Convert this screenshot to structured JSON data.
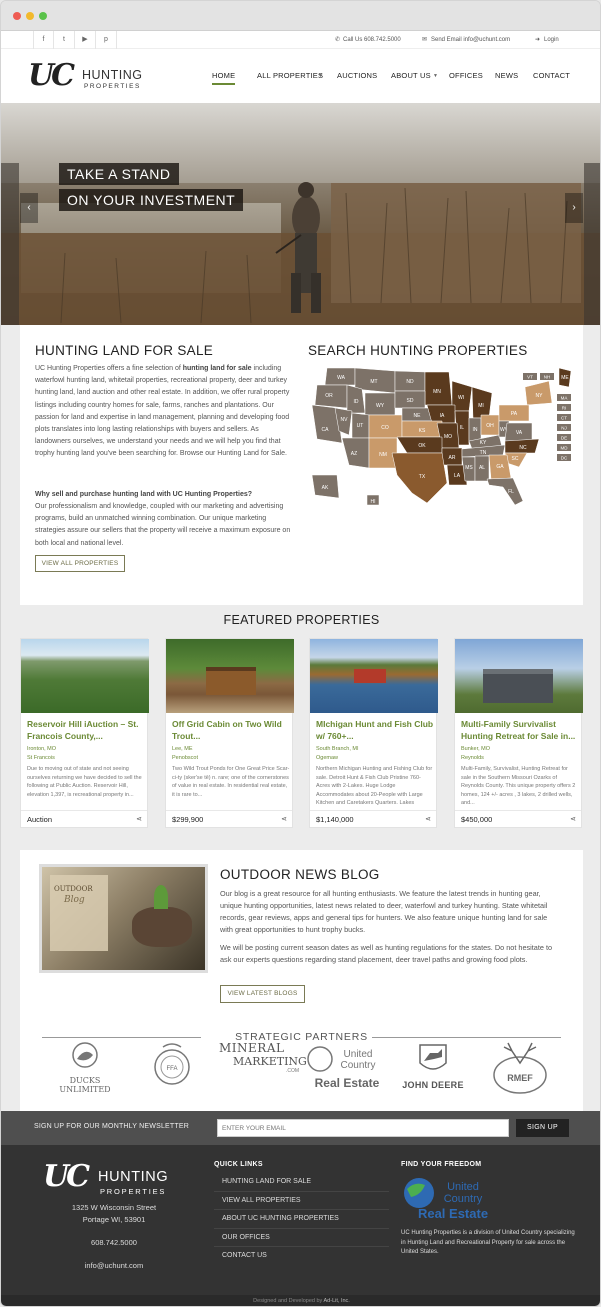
{
  "topbar": {
    "social": [
      "f",
      "t",
      "▶",
      "p"
    ],
    "call": "Call Us 608.742.5000",
    "email": "Send Email info@uchunt.com",
    "login": "Login"
  },
  "logo": {
    "uc": "UC",
    "hunting": "HUNTING",
    "properties": "PROPERTIES"
  },
  "nav": {
    "home": "HOME",
    "all_properties": "ALL PROPERTIES",
    "auctions": "AUCTIONS",
    "about": "ABOUT US",
    "offices": "OFFICES",
    "news": "NEWS",
    "contact": "CONTACT"
  },
  "hero": {
    "line1": "TAKE A STAND",
    "line2": "ON YOUR INVESTMENT"
  },
  "intro": {
    "title": "HUNTING LAND FOR SALE",
    "p1_before": "UC Hunting Properties offers a fine selection of ",
    "p1_bold": "hunting land for sale",
    "p1_after": " including waterfowl hunting land, whitetail properties, recreational property, deer and turkey hunting land, land auction and other real estate. In addition, we offer rural property listings including country homes for sale, farms, ranches and plantations. Our passion for land and expertise in land management, planning and developing food plots translates into long lasting relationships with buyers and sellers. As landowners ourselves, we understand your needs and we will help you find that trophy hunting land you've been searching for. Browse our Hunting Land for Sale.",
    "question": "Why sell and purchase hunting land with UC Hunting Properties?",
    "p2": "Our professionalism and knowledge, coupled with our marketing and advertising programs, build an unmatched winning combination. Our unique marketing strategies assure our sellers that the property will receive a maximum exposure on both local and national level.",
    "button": "VIEW ALL PROPERTIES",
    "search_title": "SEARCH HUNTING PROPERTIES"
  },
  "map_states": {
    "WA": "WA",
    "MT": "MT",
    "ND": "ND",
    "MN": "MN",
    "OR": "OR",
    "ID": "ID",
    "SD": "SD",
    "WY": "WY",
    "WI": "WI",
    "MI": "MI",
    "NY": "NY",
    "ME": "ME",
    "NV": "NV",
    "UT": "UT",
    "NE": "NE",
    "IA": "IA",
    "IL": "IL",
    "IN": "IN",
    "OH": "OH",
    "PA": "PA",
    "CA": "CA",
    "CO": "CO",
    "KS": "KS",
    "MO": "MO",
    "KY": "KY",
    "WV": "WV",
    "VA": "VA",
    "AZ": "AZ",
    "NM": "NM",
    "OK": "OK",
    "AR": "AR",
    "TN": "TN",
    "NC": "NC",
    "SC": "SC",
    "TX": "TX",
    "LA": "LA",
    "MS": "MS",
    "AL": "AL",
    "GA": "GA",
    "FL": "FL",
    "AK": "AK",
    "HI": "HI",
    "VT": "VT",
    "NH": "NH",
    "MA": "MA",
    "RI": "RI",
    "CT": "CT",
    "NJ": "NJ",
    "DE": "DE",
    "MD": "MD",
    "DC": "DC"
  },
  "featured": {
    "title": "FEATURED PROPERTIES",
    "cards": [
      {
        "title": "Reservoir Hill iAuction – St. Francois County,...",
        "loc1": "Ironton, MO",
        "loc2": "St Francois",
        "desc": "Due to moving out of state and not seeing ourselves returning we have decided to sell the following at Public Auction. Reservoir Hill, elevation 1,397, is recreational property in...",
        "price": "Auction"
      },
      {
        "title": "Off Grid Cabin on Two Wild Trout...",
        "loc1": "Lee, ME",
        "loc2": "Penobscot",
        "desc": "Two Wild Trout Ponds for One Great Price Scar-ci-ty (sker'se tē) n. rare; one of the cornerstones of value in real estate. In residential real estate, it is rare to...",
        "price": "$299,900"
      },
      {
        "title": "MIchigan Hunt and Fish Club w/ 760+...",
        "loc1": "South Branch, MI",
        "loc2": "Ogemaw",
        "desc": "Northern Michigan Hunting and Fishing Club for sale. Detroit Hunt & Fish Club Pristine 760-Acres with 2-Lakes. Huge Lodge Accommodates about 20-People with Large Kitchen and Caretakers Quarters. Lakes",
        "price": "$1,140,000"
      },
      {
        "title": "Multi-Family Survivalist Hunting Retreat for Sale in...",
        "loc1": "Bunker, MO",
        "loc2": "Reynolds",
        "desc": "Multi-Family, Survivalist, Hunting Retreat for sale in the Southern Missouri Ozarks of Reynolds County. This unique property offers 2 homes, 124 +/- acres , 3 lakes, 2 drilled wells, and...",
        "price": "$450,000"
      }
    ]
  },
  "blog": {
    "title": "OUTDOOR NEWS BLOG",
    "img_line1": "OUTDOOR",
    "img_line2": "Blog",
    "p1": "Our blog is a great resource for all hunting enthusiasts. We feature the latest trends in hunting gear, unique hunting opportunities, latest news related to deer, waterfowl and turkey hunting. State whitetail records, gear reviews, apps and general tips for hunters. We also feature unique hunting land for sale with great opportunities to hunt trophy bucks.",
    "p2": "We will be posting current season dates as well as hunting regulations for the states. Do not hesitate to ask our experts questions regarding stand placement, deer travel paths and growing food plots.",
    "button": "VIEW LATEST BLOGS"
  },
  "partners": {
    "title": "STRATEGIC PARTNERS",
    "ducks": "DUCKS UNLIMITED",
    "ffa": "FFA",
    "mineral_a": "MINERAL",
    "mineral_b": "MARKETING",
    "mineral_c": ".COM",
    "uc_a": "United",
    "uc_b": "Country",
    "uc_c": "Real Estate",
    "deere": "JOHN DEERE",
    "rmef": "RMEF"
  },
  "newsletter": {
    "label": "SIGN UP FOR OUR MONTHLY NEWSLETTER",
    "placeholder": "ENTER YOUR EMAIL",
    "button": "SIGN UP"
  },
  "footer": {
    "address1": "1325 W Wisconsin Street",
    "address2": "Portage WI, 53901",
    "phone": "608.742.5000",
    "email": "info@uchunt.com",
    "quick_links_title": "QUICK LINKS",
    "links": [
      "HUNTING LAND FOR SALE",
      "VIEW ALL PROPERTIES",
      "ABOUT UC HUNTING PROPERTIES",
      "OUR OFFICES",
      "CONTACT US"
    ],
    "freedom_title": "FIND YOUR FREEDOM",
    "freedom_text": "UC Hunting Properties is a division of United Country specializing in Hunting Land and Recreational Property for sale across the United States.",
    "credit_prefix": "Designed and Developed by ",
    "credit_link": "Ad-Lit, Inc."
  },
  "colors": {
    "accent": "#6b8a35",
    "brown_dark": "#5a3a1e",
    "brown_mid": "#8a6a48",
    "tan": "#c99a6a",
    "gray_state": "#7d7268"
  }
}
